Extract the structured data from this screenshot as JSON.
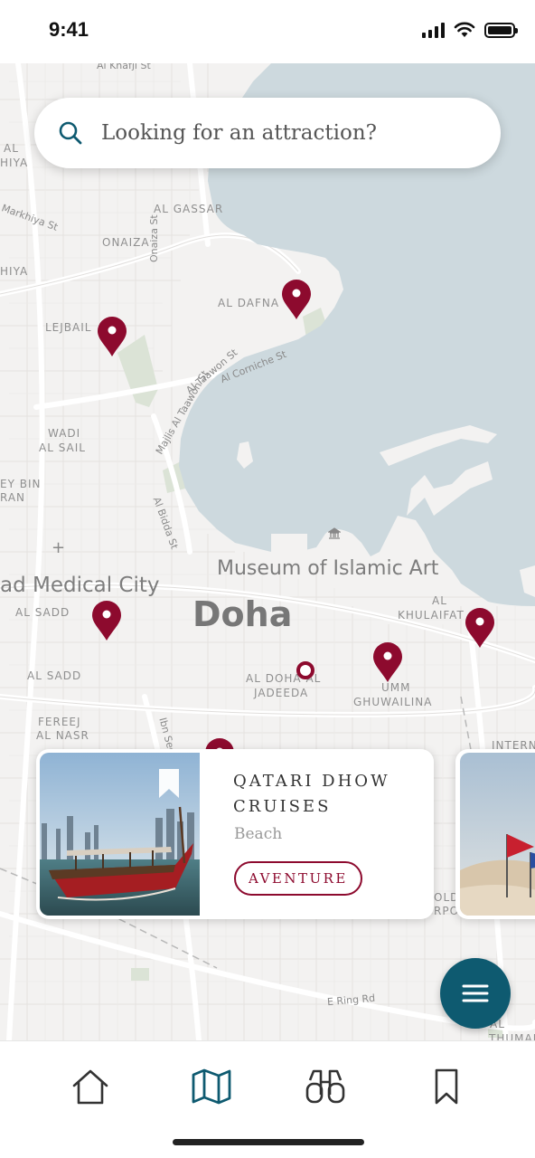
{
  "status_bar": {
    "time": "9:41",
    "icons": [
      "signal-icon",
      "wifi-icon",
      "battery-icon"
    ]
  },
  "search": {
    "placeholder": "Looking for an attraction?",
    "icon": "search-icon"
  },
  "map": {
    "labels": {
      "al_khafji_st": "Al Khafji St",
      "al_hiya_1": "AL",
      "al_hiya_2": "HIYA",
      "al_gassar": "AL GASSAR",
      "onaiza": "ONAIZA",
      "onaiza_st": "Onaiza St",
      "markhiya_st": "Markhiya St",
      "hiya": "HIYA",
      "lejbailat": "LEJBAIL",
      "al_dafna": "AL DAFNA",
      "al_corniche_st": "Al Corniche St",
      "al_taawon_st": "Al Taawon St",
      "majlis_st": "Majlis Al Taawon St",
      "wadi_al_sail_1": "WADI",
      "wadi_al_sail_2": "AL SAIL",
      "dey_bin_1": "EY BIN",
      "dey_bin_2": "RAN",
      "al_bidda_st": "Al Bidda St",
      "museum": "Museum of Islamic Art",
      "medical_city": "ad Medical City",
      "al_sadd_1": "AL SADD",
      "doha": "Doha",
      "al_khulaifat_1": "AL",
      "al_khulaifat_2": "KHULAIFAT",
      "al_sadd_2": "AL SADD",
      "al_doha_1": "AL DOHA AL",
      "al_doha_2": "JADEEDA",
      "umm_ghuwailina_1": "UMM",
      "umm_ghuwailina_2": "GHUWAILINA",
      "fereej_1": "FEREEJ",
      "fereej_2": "AL NASR",
      "ibn_seena": "Ibn Seen",
      "e_ring_rd": "E Ring Rd",
      "al_thumama_1": "AL",
      "al_thumama_2": "THUMAMA",
      "old_1": "OLD",
      "old_2": "RPO",
      "intern": "INTERN"
    },
    "pin_color": "#8d0a2e",
    "water_color": "#cdd9de"
  },
  "card": {
    "title": "QATARI DHOW CRUISES",
    "category": "Beach",
    "tag": "AVENTURE",
    "bookmark_icon": "bookmark-icon"
  },
  "fab": {
    "icon": "menu-icon",
    "color": "#0e5a70"
  },
  "bottom_nav": {
    "items": [
      {
        "icon": "home-icon",
        "active": false
      },
      {
        "icon": "map-icon",
        "active": true
      },
      {
        "icon": "binoculars-icon",
        "active": false
      },
      {
        "icon": "bookmark-icon",
        "active": false
      }
    ],
    "active_color": "#0e5a70"
  }
}
